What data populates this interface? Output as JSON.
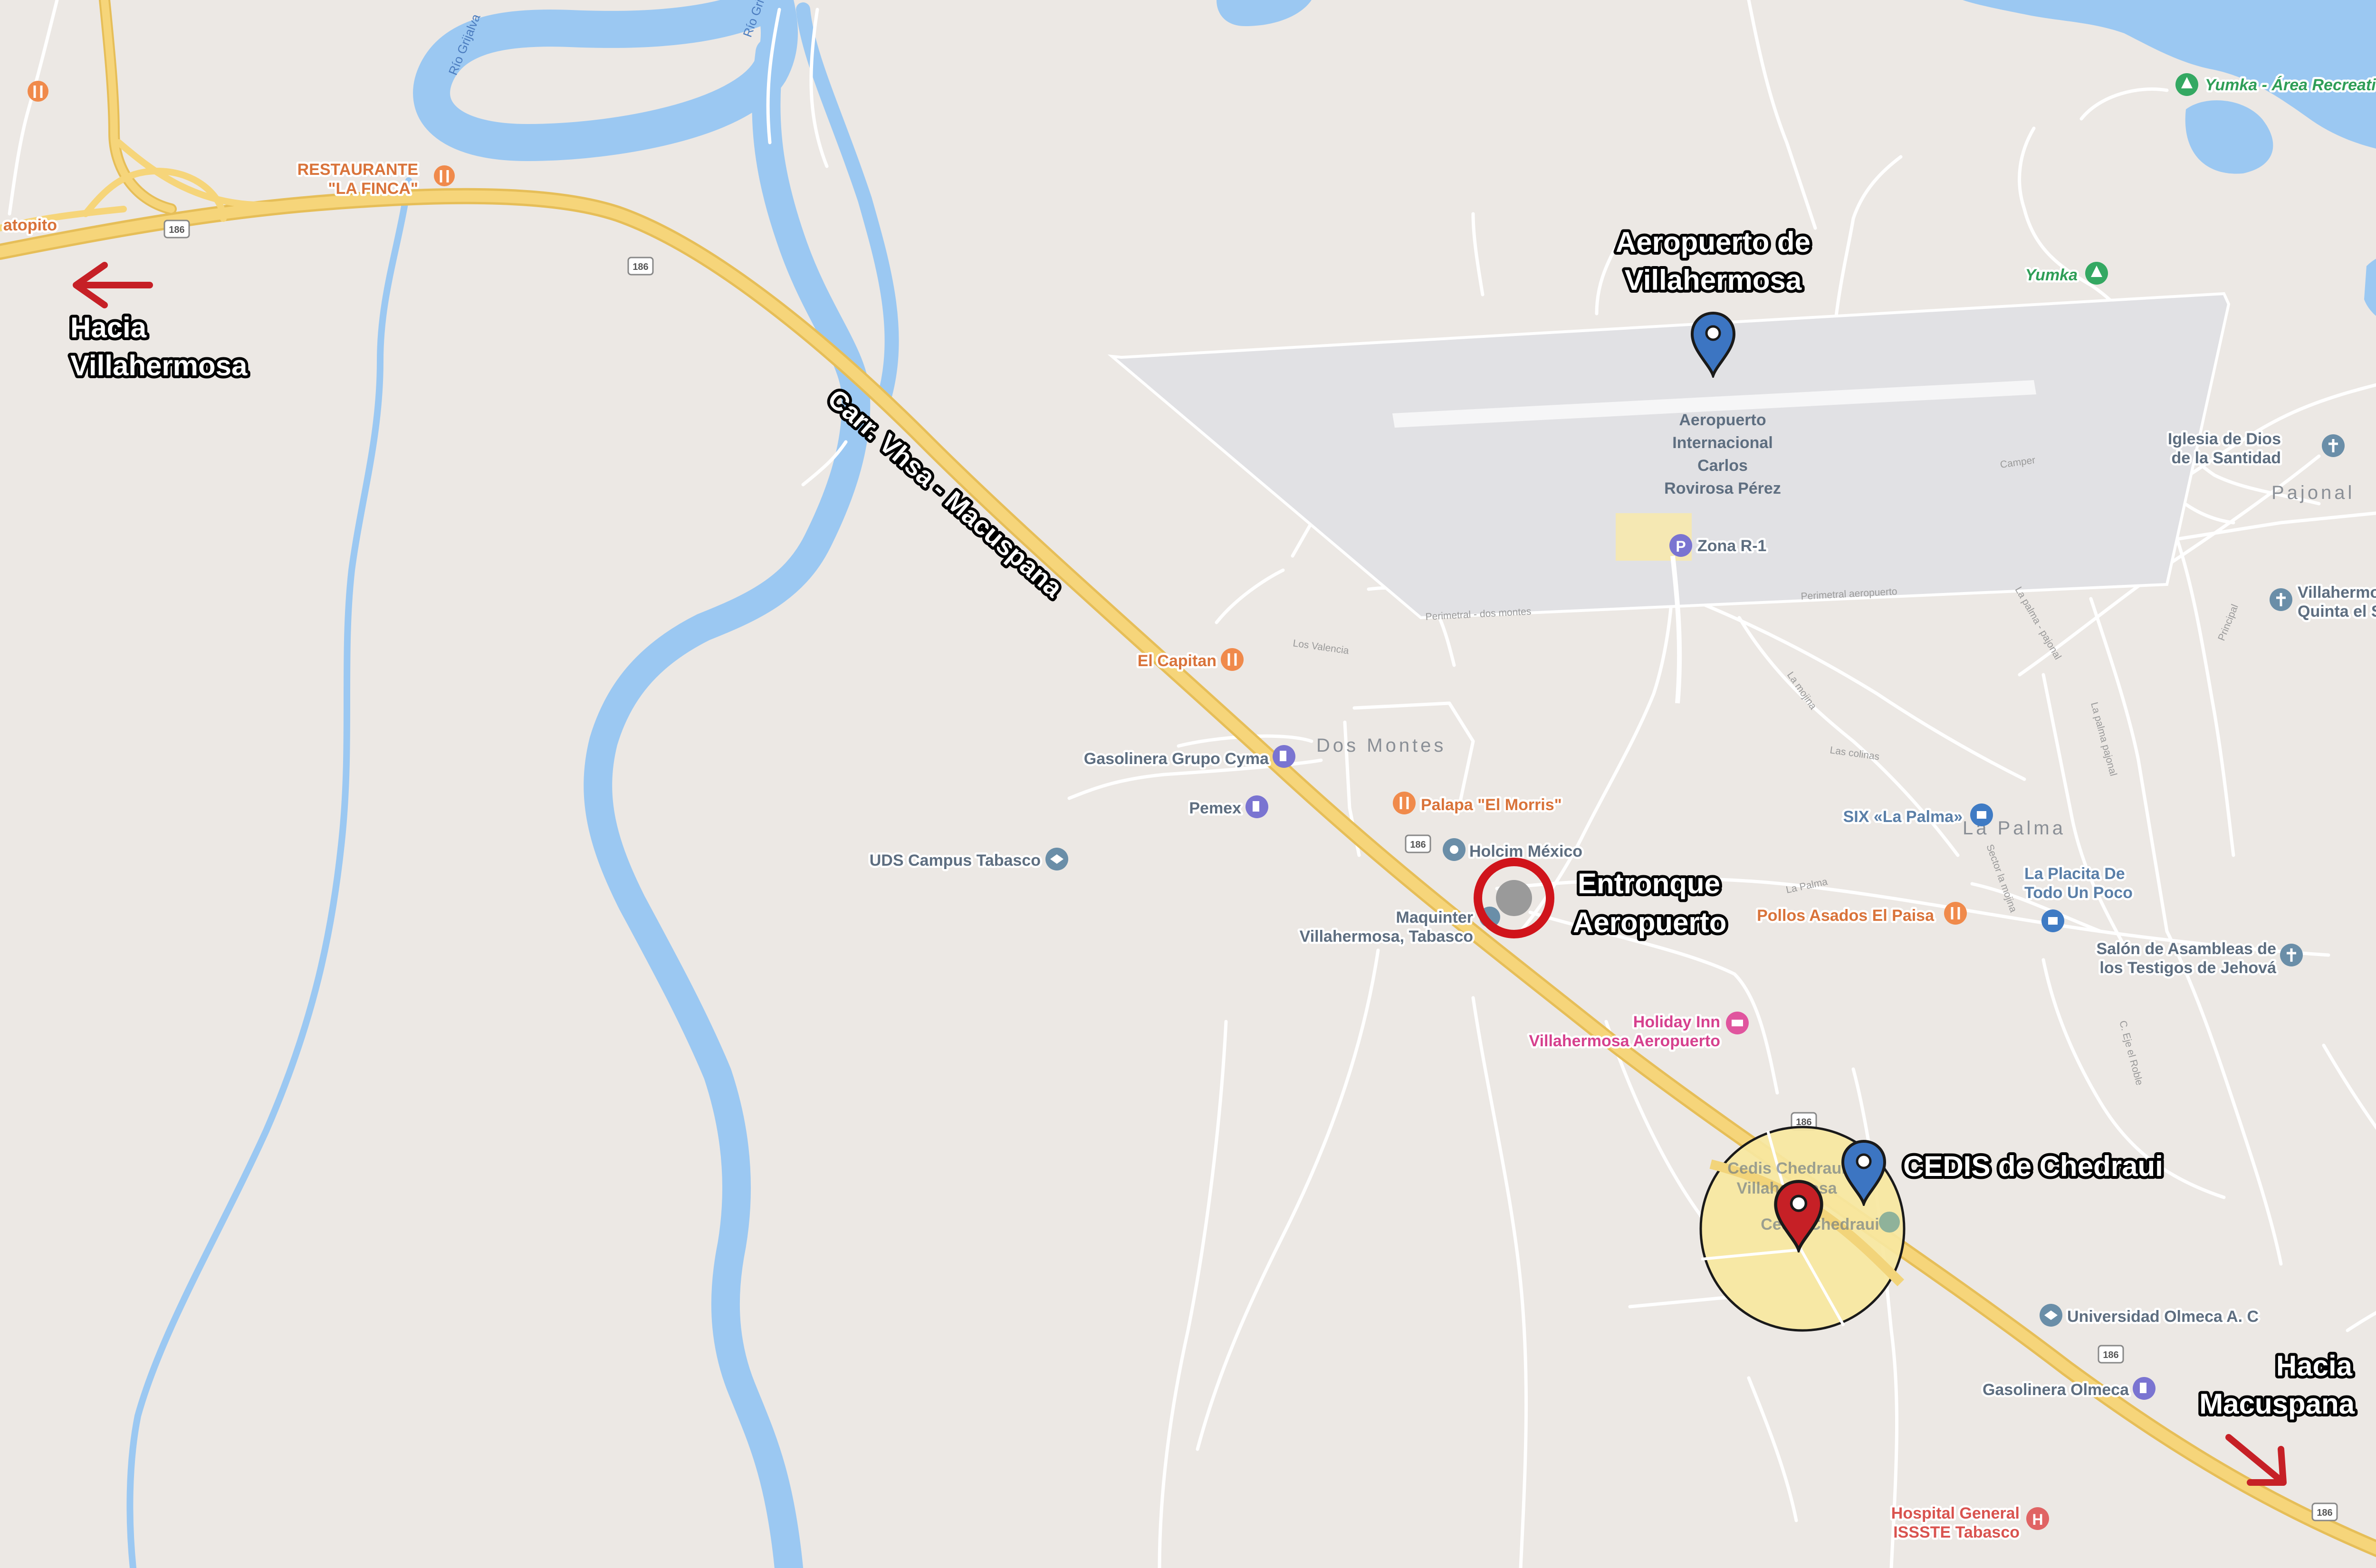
{
  "map": {
    "road_name": "Carr. Vhsa - Macuspana",
    "route_number": "186",
    "rivers": [
      "Río Grijalva",
      "Río Gri"
    ],
    "localities": [
      "Dos Montes",
      "La Palma",
      "Pajonal"
    ],
    "streets": [
      "Perimetral - dos montes",
      "Perimetral aeropuerto",
      "Los Valencia",
      "La Palma",
      "La mojina",
      "La palma - pajonal",
      "La palma pajonal",
      "Las colinas",
      "Sector la mojina",
      "C. Eje el Roble",
      "Principal",
      "Camper"
    ]
  },
  "callouts": {
    "to_villahermosa": [
      "Hacia",
      "Villahermosa"
    ],
    "to_macuspana": [
      "Hacia",
      "Macuspana"
    ],
    "airport": [
      "Aeropuerto de",
      "Villahermosa"
    ],
    "junction": [
      "Entronque",
      "Aeropuerto"
    ],
    "cedis": "CEDIS de Chedraui"
  },
  "pois": {
    "restaurante_finca": [
      "RESTAURANTE",
      "\"LA FINCA\""
    ],
    "atopito": "atopito",
    "yumka_area": "Yumka - Área Recreativa",
    "yumka": "Yumka",
    "airport_name": [
      "Aeropuerto",
      "Internacional",
      "Carlos",
      "Rovirosa Pérez"
    ],
    "zona_r1": "Zona R-1",
    "iglesia": [
      "Iglesia de Dios",
      "de la Santidad"
    ],
    "villahermosa_quinta": [
      "Villahermosa - C",
      "Quinta el Sacrific"
    ],
    "el_capitan": "El Capitan",
    "gasolinera_cyma": "Gasolinera Grupo Cyma",
    "pemex": "Pemex",
    "uds": "UDS Campus Tabasco",
    "palapa": "Palapa \"El Morris\"",
    "holcim": "Holcim México",
    "maquinter": [
      "Maquinter",
      "Villahermosa, Tabasco"
    ],
    "six": "SIX «La Palma»",
    "placita": [
      "La Placita De",
      "Todo Un Poco"
    ],
    "pollos": "Pollos Asados El Paisa",
    "salon": [
      "Salón de Asambleas de",
      "los Testigos de Jehová"
    ],
    "holiday_inn": [
      "Holiday Inn",
      "Villahermosa Aeropuerto"
    ],
    "cedis_chedraui": [
      "Cedis Chedraui",
      "Villahermosa"
    ],
    "cedis_chedraui2": "Cedis Chedraui",
    "universidad": "Universidad Olmeca A. C",
    "gasolinera_olmeca": "Gasolinera Olmeca",
    "hospital": [
      "Hospital General",
      "ISSSTE Tabasco"
    ]
  },
  "colors": {
    "land": "#ECE8E4",
    "water": "#9BC8F2",
    "highway": "#F6D57A",
    "airport_area": "#E1E1E4",
    "marker_blue": "#3C75C2",
    "marker_red": "#C62026",
    "callout_arrow": "#C62026"
  }
}
